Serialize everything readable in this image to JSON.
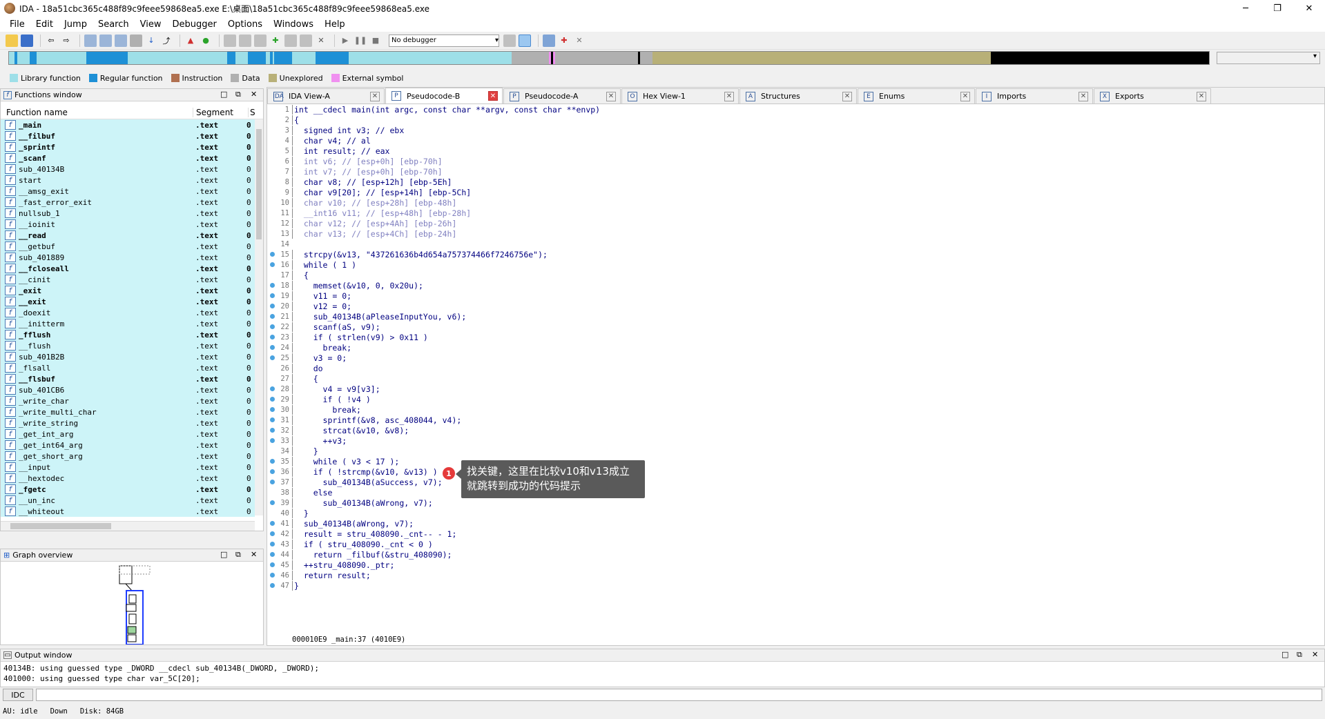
{
  "window": {
    "title": "IDA - 18a51cbc365c488f89c9feee59868ea5.exe E:\\桌面\\18a51cbc365c488f89c9feee59868ea5.exe",
    "minimize": "─",
    "maximize": "❐",
    "close": "✕"
  },
  "menu": [
    "File",
    "Edit",
    "Jump",
    "Search",
    "View",
    "Debugger",
    "Options",
    "Windows",
    "Help"
  ],
  "toolbar": {
    "debugger_select": "No debugger"
  },
  "legend": [
    {
      "label": "Library function",
      "color": "#9edfe8"
    },
    {
      "label": "Regular function",
      "color": "#1e90d6"
    },
    {
      "label": "Instruction",
      "color": "#b07050"
    },
    {
      "label": "Data",
      "color": "#b0b0b0"
    },
    {
      "label": "Unexplored",
      "color": "#b8b078"
    },
    {
      "label": "External symbol",
      "color": "#f090f0"
    }
  ],
  "functions_window": {
    "title": "Functions window",
    "col_name": "Function name",
    "col_segment": "Segment",
    "col_s": "S",
    "rows": [
      {
        "name": "_main",
        "seg": ".text",
        "s": "0",
        "bold": true
      },
      {
        "name": "__filbuf",
        "seg": ".text",
        "s": "0",
        "bold": true
      },
      {
        "name": "_sprintf",
        "seg": ".text",
        "s": "0",
        "bold": true
      },
      {
        "name": "_scanf",
        "seg": ".text",
        "s": "0",
        "bold": true
      },
      {
        "name": "sub_40134B",
        "seg": ".text",
        "s": "0",
        "bold": false
      },
      {
        "name": "start",
        "seg": ".text",
        "s": "0",
        "bold": false
      },
      {
        "name": "__amsg_exit",
        "seg": ".text",
        "s": "0",
        "bold": false
      },
      {
        "name": "_fast_error_exit",
        "seg": ".text",
        "s": "0",
        "bold": false
      },
      {
        "name": "nullsub_1",
        "seg": ".text",
        "s": "0",
        "bold": false
      },
      {
        "name": "__ioinit",
        "seg": ".text",
        "s": "0",
        "bold": false
      },
      {
        "name": "__read",
        "seg": ".text",
        "s": "0",
        "bold": true
      },
      {
        "name": "__getbuf",
        "seg": ".text",
        "s": "0",
        "bold": false
      },
      {
        "name": "sub_401889",
        "seg": ".text",
        "s": "0",
        "bold": false
      },
      {
        "name": "__fcloseall",
        "seg": ".text",
        "s": "0",
        "bold": true
      },
      {
        "name": "__cinit",
        "seg": ".text",
        "s": "0",
        "bold": false
      },
      {
        "name": "_exit",
        "seg": ".text",
        "s": "0",
        "bold": true
      },
      {
        "name": "__exit",
        "seg": ".text",
        "s": "0",
        "bold": true
      },
      {
        "name": "_doexit",
        "seg": ".text",
        "s": "0",
        "bold": false
      },
      {
        "name": "__initterm",
        "seg": ".text",
        "s": "0",
        "bold": false
      },
      {
        "name": "_fflush",
        "seg": ".text",
        "s": "0",
        "bold": true
      },
      {
        "name": "__flush",
        "seg": ".text",
        "s": "0",
        "bold": false
      },
      {
        "name": "sub_401B2B",
        "seg": ".text",
        "s": "0",
        "bold": false
      },
      {
        "name": "_flsall",
        "seg": ".text",
        "s": "0",
        "bold": false
      },
      {
        "name": "__flsbuf",
        "seg": ".text",
        "s": "0",
        "bold": true
      },
      {
        "name": "sub_401CB6",
        "seg": ".text",
        "s": "0",
        "bold": false
      },
      {
        "name": "_write_char",
        "seg": ".text",
        "s": "0",
        "bold": false
      },
      {
        "name": "_write_multi_char",
        "seg": ".text",
        "s": "0",
        "bold": false
      },
      {
        "name": "_write_string",
        "seg": ".text",
        "s": "0",
        "bold": false
      },
      {
        "name": "_get_int_arg",
        "seg": ".text",
        "s": "0",
        "bold": false
      },
      {
        "name": "_get_int64_arg",
        "seg": ".text",
        "s": "0",
        "bold": false
      },
      {
        "name": "_get_short_arg",
        "seg": ".text",
        "s": "0",
        "bold": false
      },
      {
        "name": "__input",
        "seg": ".text",
        "s": "0",
        "bold": false
      },
      {
        "name": "__hextodec",
        "seg": ".text",
        "s": "0",
        "bold": false
      },
      {
        "name": "_fgetc",
        "seg": ".text",
        "s": "0",
        "bold": true
      },
      {
        "name": "__un_inc",
        "seg": ".text",
        "s": "0",
        "bold": false
      },
      {
        "name": "__whiteout",
        "seg": ".text",
        "s": "0",
        "bold": false
      }
    ]
  },
  "graph_overview": {
    "title": "Graph overview"
  },
  "tabs": [
    {
      "label": "IDA View-A",
      "icon": "IDA",
      "active": false
    },
    {
      "label": "Pseudocode-B",
      "icon": "P",
      "active": true
    },
    {
      "label": "Pseudocode-A",
      "icon": "P",
      "active": false
    },
    {
      "label": "Hex View-1",
      "icon": "O",
      "active": false
    },
    {
      "label": "Structures",
      "icon": "A",
      "active": false
    },
    {
      "label": "Enums",
      "icon": "E",
      "active": false
    },
    {
      "label": "Imports",
      "icon": "I",
      "active": false
    },
    {
      "label": "Exports",
      "icon": "X",
      "active": false
    }
  ],
  "code_lines": [
    {
      "n": "1",
      "text": "int __cdecl main(int argc, const char **argv, const char **envp)",
      "bp": false,
      "gray": false
    },
    {
      "n": "2",
      "text": "{",
      "bp": false,
      "gray": false
    },
    {
      "n": "3",
      "text": "  signed int v3; // ebx",
      "bp": false,
      "gray": false
    },
    {
      "n": "4",
      "text": "  char v4; // al",
      "bp": false,
      "gray": false
    },
    {
      "n": "5",
      "text": "  int result; // eax",
      "bp": false,
      "gray": false
    },
    {
      "n": "6",
      "text": "  int v6; // [esp+0h] [ebp-70h]",
      "bp": false,
      "gray": true
    },
    {
      "n": "7",
      "text": "  int v7; // [esp+0h] [ebp-70h]",
      "bp": false,
      "gray": true
    },
    {
      "n": "8",
      "text": "  char v8; // [esp+12h] [ebp-5Eh]",
      "bp": false,
      "gray": false
    },
    {
      "n": "9",
      "text": "  char v9[20]; // [esp+14h] [ebp-5Ch]",
      "bp": false,
      "gray": false
    },
    {
      "n": "10",
      "text": "  char v10; // [esp+28h] [ebp-48h]",
      "bp": false,
      "gray": true
    },
    {
      "n": "11",
      "text": "  __int16 v11; // [esp+48h] [ebp-28h]",
      "bp": false,
      "gray": true
    },
    {
      "n": "12",
      "text": "  char v12; // [esp+4Ah] [ebp-26h]",
      "bp": false,
      "gray": true
    },
    {
      "n": "13",
      "text": "  char v13; // [esp+4Ch] [ebp-24h]",
      "bp": false,
      "gray": true
    },
    {
      "n": "14",
      "text": "",
      "bp": false,
      "gray": false
    },
    {
      "n": "15",
      "text": "  strcpy(&v13, \"437261636b4d654a757374466f7246756e\");",
      "bp": true,
      "gray": false
    },
    {
      "n": "16",
      "text": "  while ( 1 )",
      "bp": true,
      "gray": false
    },
    {
      "n": "17",
      "text": "  {",
      "bp": false,
      "gray": false
    },
    {
      "n": "18",
      "text": "    memset(&v10, 0, 0x20u);",
      "bp": true,
      "gray": false
    },
    {
      "n": "19",
      "text": "    v11 = 0;",
      "bp": true,
      "gray": false
    },
    {
      "n": "20",
      "text": "    v12 = 0;",
      "bp": true,
      "gray": false
    },
    {
      "n": "21",
      "text": "    sub_40134B(aPleaseInputYou, v6);",
      "bp": true,
      "gray": false
    },
    {
      "n": "22",
      "text": "    scanf(aS, v9);",
      "bp": true,
      "gray": false
    },
    {
      "n": "23",
      "text": "    if ( strlen(v9) > 0x11 )",
      "bp": true,
      "gray": false
    },
    {
      "n": "24",
      "text": "      break;",
      "bp": true,
      "gray": false
    },
    {
      "n": "25",
      "text": "    v3 = 0;",
      "bp": true,
      "gray": false
    },
    {
      "n": "26",
      "text": "    do",
      "bp": false,
      "gray": false
    },
    {
      "n": "27",
      "text": "    {",
      "bp": false,
      "gray": false
    },
    {
      "n": "28",
      "text": "      v4 = v9[v3];",
      "bp": true,
      "gray": false
    },
    {
      "n": "29",
      "text": "      if ( !v4 )",
      "bp": true,
      "gray": false
    },
    {
      "n": "30",
      "text": "        break;",
      "bp": true,
      "gray": false
    },
    {
      "n": "31",
      "text": "      sprintf(&v8, asc_408044, v4);",
      "bp": true,
      "gray": false
    },
    {
      "n": "32",
      "text": "      strcat(&v10, &v8);",
      "bp": true,
      "gray": false
    },
    {
      "n": "33",
      "text": "      ++v3;",
      "bp": true,
      "gray": false
    },
    {
      "n": "34",
      "text": "    }",
      "bp": false,
      "gray": false
    },
    {
      "n": "35",
      "text": "    while ( v3 < 17 );",
      "bp": true,
      "gray": false
    },
    {
      "n": "36",
      "text": "    if ( !strcmp(&v10, &v13) )",
      "bp": true,
      "gray": false
    },
    {
      "n": "37",
      "text": "      sub_40134B(aSuccess, v7);",
      "bp": true,
      "gray": false
    },
    {
      "n": "38",
      "text": "    else",
      "bp": false,
      "gray": false
    },
    {
      "n": "39",
      "text": "      sub_40134B(aWrong, v7);",
      "bp": true,
      "gray": false
    },
    {
      "n": "40",
      "text": "  }",
      "bp": false,
      "gray": false
    },
    {
      "n": "41",
      "text": "  sub_40134B(aWrong, v7);",
      "bp": true,
      "gray": false
    },
    {
      "n": "42",
      "text": "  result = stru_408090._cnt-- - 1;",
      "bp": true,
      "gray": false
    },
    {
      "n": "43",
      "text": "  if ( stru_408090._cnt < 0 )",
      "bp": true,
      "gray": false
    },
    {
      "n": "44",
      "text": "    return _filbuf(&stru_408090);",
      "bp": true,
      "gray": false
    },
    {
      "n": "45",
      "text": "  ++stru_408090._ptr;",
      "bp": true,
      "gray": false
    },
    {
      "n": "46",
      "text": "  return result;",
      "bp": true,
      "gray": false
    },
    {
      "n": "47",
      "text": "}",
      "bp": true,
      "gray": false
    }
  ],
  "code_status": "000010E9 _main:37 (4010E9)",
  "callout": {
    "badge": "1",
    "text_line1": "找关键，这里在比较v10和v13成立",
    "text_line2": "就跳转到成功的代码提示"
  },
  "output_window": {
    "title": "Output window",
    "lines": [
      "40134B: using guessed type _DWORD __cdecl sub_40134B(_DWORD, _DWORD);",
      "401000: using guessed type char var_5C[20];"
    ]
  },
  "idc_button": "IDC",
  "status": {
    "au": "AU:  idle",
    "dir": "Down",
    "disk": "Disk: 84GB"
  }
}
